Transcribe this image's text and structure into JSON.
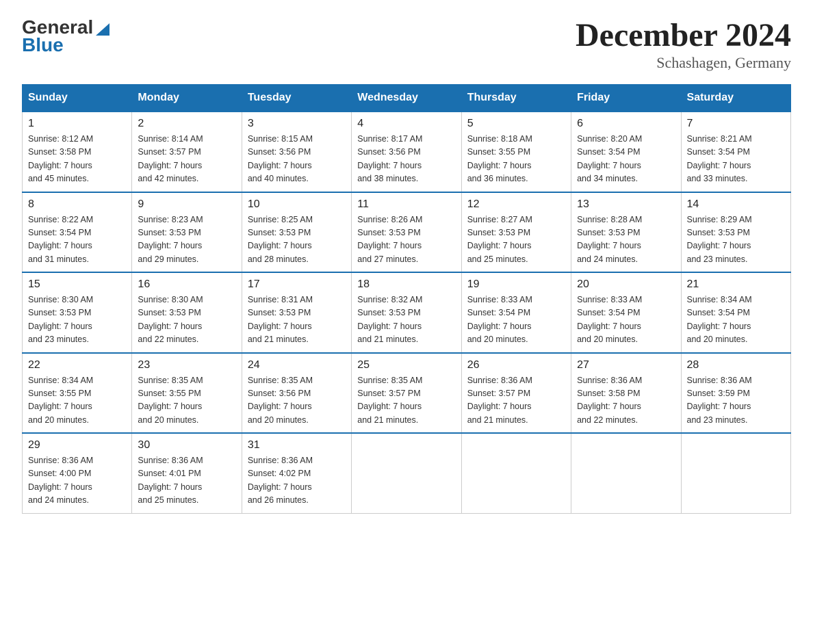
{
  "logo": {
    "general": "General",
    "blue": "Blue"
  },
  "title": {
    "month_year": "December 2024",
    "location": "Schashagen, Germany"
  },
  "days_of_week": [
    "Sunday",
    "Monday",
    "Tuesday",
    "Wednesday",
    "Thursday",
    "Friday",
    "Saturday"
  ],
  "weeks": [
    [
      {
        "day": "1",
        "sunrise": "8:12 AM",
        "sunset": "3:58 PM",
        "daylight": "7 hours and 45 minutes."
      },
      {
        "day": "2",
        "sunrise": "8:14 AM",
        "sunset": "3:57 PM",
        "daylight": "7 hours and 42 minutes."
      },
      {
        "day": "3",
        "sunrise": "8:15 AM",
        "sunset": "3:56 PM",
        "daylight": "7 hours and 40 minutes."
      },
      {
        "day": "4",
        "sunrise": "8:17 AM",
        "sunset": "3:56 PM",
        "daylight": "7 hours and 38 minutes."
      },
      {
        "day": "5",
        "sunrise": "8:18 AM",
        "sunset": "3:55 PM",
        "daylight": "7 hours and 36 minutes."
      },
      {
        "day": "6",
        "sunrise": "8:20 AM",
        "sunset": "3:54 PM",
        "daylight": "7 hours and 34 minutes."
      },
      {
        "day": "7",
        "sunrise": "8:21 AM",
        "sunset": "3:54 PM",
        "daylight": "7 hours and 33 minutes."
      }
    ],
    [
      {
        "day": "8",
        "sunrise": "8:22 AM",
        "sunset": "3:54 PM",
        "daylight": "7 hours and 31 minutes."
      },
      {
        "day": "9",
        "sunrise": "8:23 AM",
        "sunset": "3:53 PM",
        "daylight": "7 hours and 29 minutes."
      },
      {
        "day": "10",
        "sunrise": "8:25 AM",
        "sunset": "3:53 PM",
        "daylight": "7 hours and 28 minutes."
      },
      {
        "day": "11",
        "sunrise": "8:26 AM",
        "sunset": "3:53 PM",
        "daylight": "7 hours and 27 minutes."
      },
      {
        "day": "12",
        "sunrise": "8:27 AM",
        "sunset": "3:53 PM",
        "daylight": "7 hours and 25 minutes."
      },
      {
        "day": "13",
        "sunrise": "8:28 AM",
        "sunset": "3:53 PM",
        "daylight": "7 hours and 24 minutes."
      },
      {
        "day": "14",
        "sunrise": "8:29 AM",
        "sunset": "3:53 PM",
        "daylight": "7 hours and 23 minutes."
      }
    ],
    [
      {
        "day": "15",
        "sunrise": "8:30 AM",
        "sunset": "3:53 PM",
        "daylight": "7 hours and 23 minutes."
      },
      {
        "day": "16",
        "sunrise": "8:30 AM",
        "sunset": "3:53 PM",
        "daylight": "7 hours and 22 minutes."
      },
      {
        "day": "17",
        "sunrise": "8:31 AM",
        "sunset": "3:53 PM",
        "daylight": "7 hours and 21 minutes."
      },
      {
        "day": "18",
        "sunrise": "8:32 AM",
        "sunset": "3:53 PM",
        "daylight": "7 hours and 21 minutes."
      },
      {
        "day": "19",
        "sunrise": "8:33 AM",
        "sunset": "3:54 PM",
        "daylight": "7 hours and 20 minutes."
      },
      {
        "day": "20",
        "sunrise": "8:33 AM",
        "sunset": "3:54 PM",
        "daylight": "7 hours and 20 minutes."
      },
      {
        "day": "21",
        "sunrise": "8:34 AM",
        "sunset": "3:54 PM",
        "daylight": "7 hours and 20 minutes."
      }
    ],
    [
      {
        "day": "22",
        "sunrise": "8:34 AM",
        "sunset": "3:55 PM",
        "daylight": "7 hours and 20 minutes."
      },
      {
        "day": "23",
        "sunrise": "8:35 AM",
        "sunset": "3:55 PM",
        "daylight": "7 hours and 20 minutes."
      },
      {
        "day": "24",
        "sunrise": "8:35 AM",
        "sunset": "3:56 PM",
        "daylight": "7 hours and 20 minutes."
      },
      {
        "day": "25",
        "sunrise": "8:35 AM",
        "sunset": "3:57 PM",
        "daylight": "7 hours and 21 minutes."
      },
      {
        "day": "26",
        "sunrise": "8:36 AM",
        "sunset": "3:57 PM",
        "daylight": "7 hours and 21 minutes."
      },
      {
        "day": "27",
        "sunrise": "8:36 AM",
        "sunset": "3:58 PM",
        "daylight": "7 hours and 22 minutes."
      },
      {
        "day": "28",
        "sunrise": "8:36 AM",
        "sunset": "3:59 PM",
        "daylight": "7 hours and 23 minutes."
      }
    ],
    [
      {
        "day": "29",
        "sunrise": "8:36 AM",
        "sunset": "4:00 PM",
        "daylight": "7 hours and 24 minutes."
      },
      {
        "day": "30",
        "sunrise": "8:36 AM",
        "sunset": "4:01 PM",
        "daylight": "7 hours and 25 minutes."
      },
      {
        "day": "31",
        "sunrise": "8:36 AM",
        "sunset": "4:02 PM",
        "daylight": "7 hours and 26 minutes."
      },
      null,
      null,
      null,
      null
    ]
  ],
  "labels": {
    "sunrise": "Sunrise:",
    "sunset": "Sunset:",
    "daylight": "Daylight:"
  }
}
